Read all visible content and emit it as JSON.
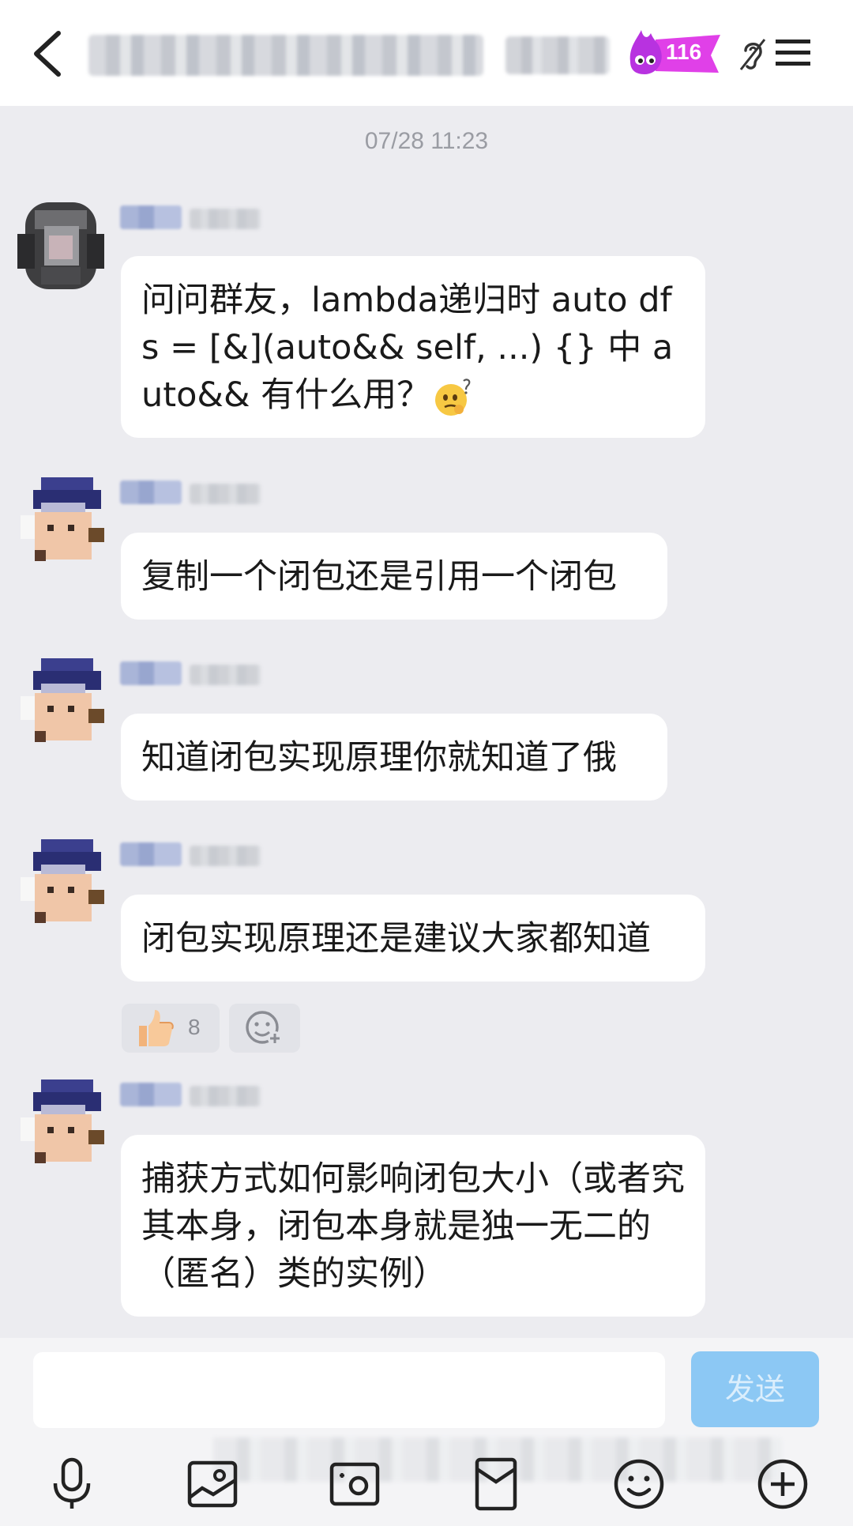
{
  "header": {
    "fire_count": "116"
  },
  "timestamp": "07/28 11:23",
  "messages": [
    {
      "text": "问问群友，lambda递归时 auto dfs = [&](auto&& self, ...) {} 中 auto&& 有什么用？"
    },
    {
      "text": "复制一个闭包还是引用一个闭包"
    },
    {
      "text": "知道闭包实现原理你就知道了俄"
    },
    {
      "text": "闭包实现原理还是建议大家都知道"
    },
    {
      "text": "捕获方式如何影响闭包大小（或者究其本身，闭包本身就是独一无二的（匿名）类的实例）"
    }
  ],
  "reaction": {
    "icon": "thumbs-up-icon",
    "count": "8"
  },
  "composer": {
    "send_label": "发送"
  },
  "toolbar": [
    "microphone-icon",
    "image-icon",
    "camera-icon",
    "red-packet-icon",
    "emoji-icon",
    "plus-icon"
  ],
  "colors": {
    "send_button": "#8cc8f4",
    "chat_bg": "#ececf0",
    "fire_badge": "#e040e8"
  }
}
